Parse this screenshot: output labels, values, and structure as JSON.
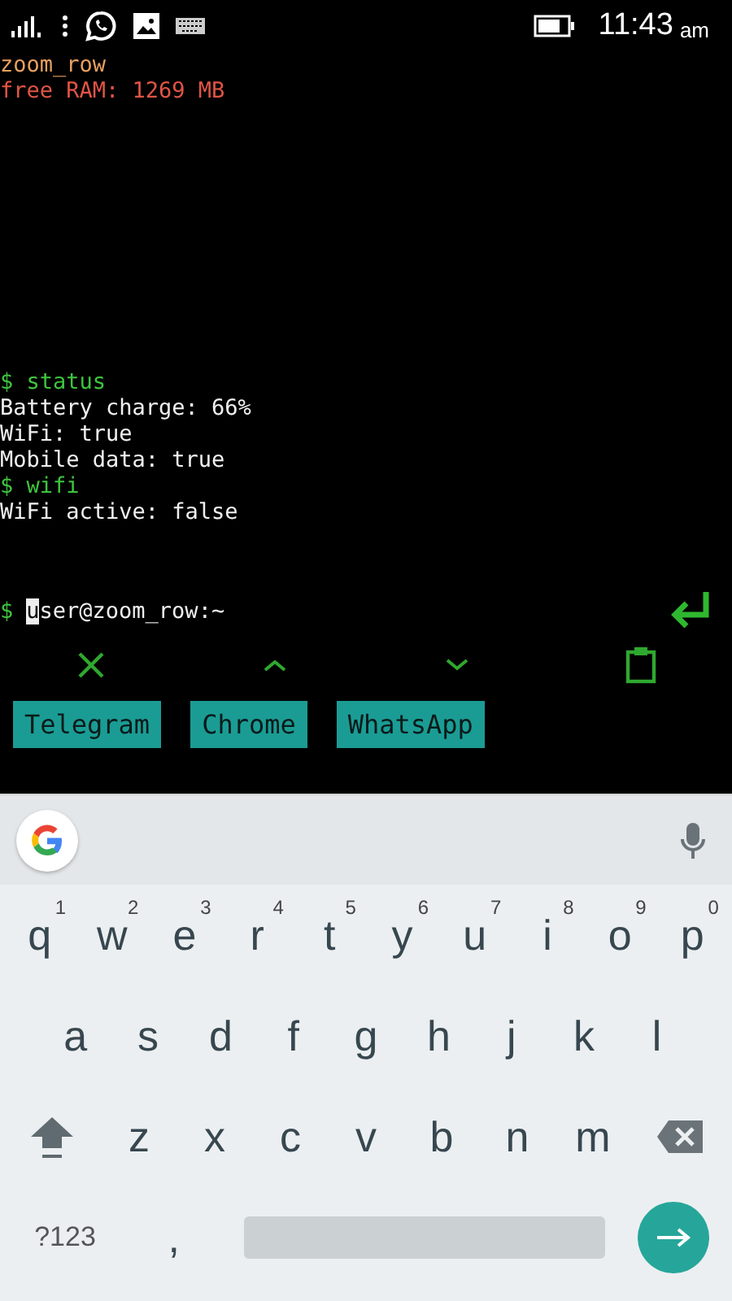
{
  "status_bar": {
    "time": "11:43",
    "ampm": "am"
  },
  "terminal": {
    "header": [
      {
        "kind": "name",
        "text": "zoom_row"
      },
      {
        "kind": "ram",
        "text": "free RAM: 1269 MB"
      }
    ],
    "output": [
      {
        "kind": "command",
        "text": "$ status"
      },
      {
        "kind": "output",
        "text": "Battery charge: 66%"
      },
      {
        "kind": "output",
        "text": "WiFi: true"
      },
      {
        "kind": "output",
        "text": "Mobile data: true"
      },
      {
        "kind": "command",
        "text": "$ wifi"
      },
      {
        "kind": "output",
        "text": "WiFi active: false"
      }
    ],
    "prompt": {
      "symbol": "$",
      "cursor_char": "u",
      "text": "ser@zoom_row:~"
    }
  },
  "extra_keys": [
    {
      "kind": "close"
    },
    {
      "kind": "up"
    },
    {
      "kind": "down"
    },
    {
      "kind": "clipboard"
    }
  ],
  "shortcuts": [
    "Telegram",
    "Chrome",
    "WhatsApp"
  ],
  "keyboard": {
    "rows": [
      [
        {
          "label": "q",
          "hint": "1"
        },
        {
          "label": "w",
          "hint": "2"
        },
        {
          "label": "e",
          "hint": "3"
        },
        {
          "label": "r",
          "hint": "4"
        },
        {
          "label": "t",
          "hint": "5"
        },
        {
          "label": "y",
          "hint": "6"
        },
        {
          "label": "u",
          "hint": "7"
        },
        {
          "label": "i",
          "hint": "8"
        },
        {
          "label": "o",
          "hint": "9"
        },
        {
          "label": "p",
          "hint": "0"
        }
      ],
      [
        {
          "label": "a"
        },
        {
          "label": "s"
        },
        {
          "label": "d"
        },
        {
          "label": "f"
        },
        {
          "label": "g"
        },
        {
          "label": "h"
        },
        {
          "label": "j"
        },
        {
          "label": "k"
        },
        {
          "label": "l"
        }
      ],
      [
        {
          "kind": "shift"
        },
        {
          "label": "z"
        },
        {
          "label": "x"
        },
        {
          "label": "c"
        },
        {
          "label": "v"
        },
        {
          "label": "b"
        },
        {
          "label": "n"
        },
        {
          "label": "m"
        },
        {
          "kind": "backspace"
        }
      ],
      [
        {
          "kind": "symbols",
          "label": "?123"
        },
        {
          "label": ","
        },
        {
          "kind": "space"
        },
        {
          "kind": "enter"
        }
      ]
    ]
  }
}
